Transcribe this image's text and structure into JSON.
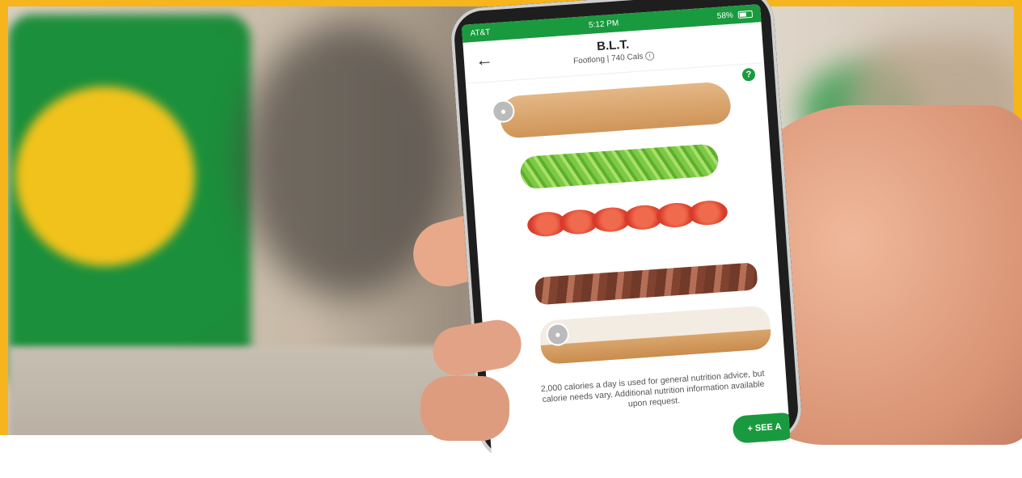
{
  "status_bar": {
    "carrier": "AT&T",
    "time": "5:12 PM",
    "battery": "58%"
  },
  "header": {
    "back_icon": "back-arrow-icon",
    "title": "B.L.T.",
    "subtitle": "Footlong | 740 Cals",
    "info_icon": "info-icon"
  },
  "help_label": "?",
  "layers": [
    "bread-top",
    "lettuce",
    "tomato",
    "bacon",
    "bread-bottom"
  ],
  "disclaimer": "2,000 calories a day is used for general nutrition advice, but calorie needs vary. Additional nutrition information available upon request.",
  "see_button": {
    "plus": "+",
    "label": "SEE A"
  },
  "colors": {
    "brand_green": "#1a9a3e",
    "frame_yellow": "#f6b51c"
  }
}
